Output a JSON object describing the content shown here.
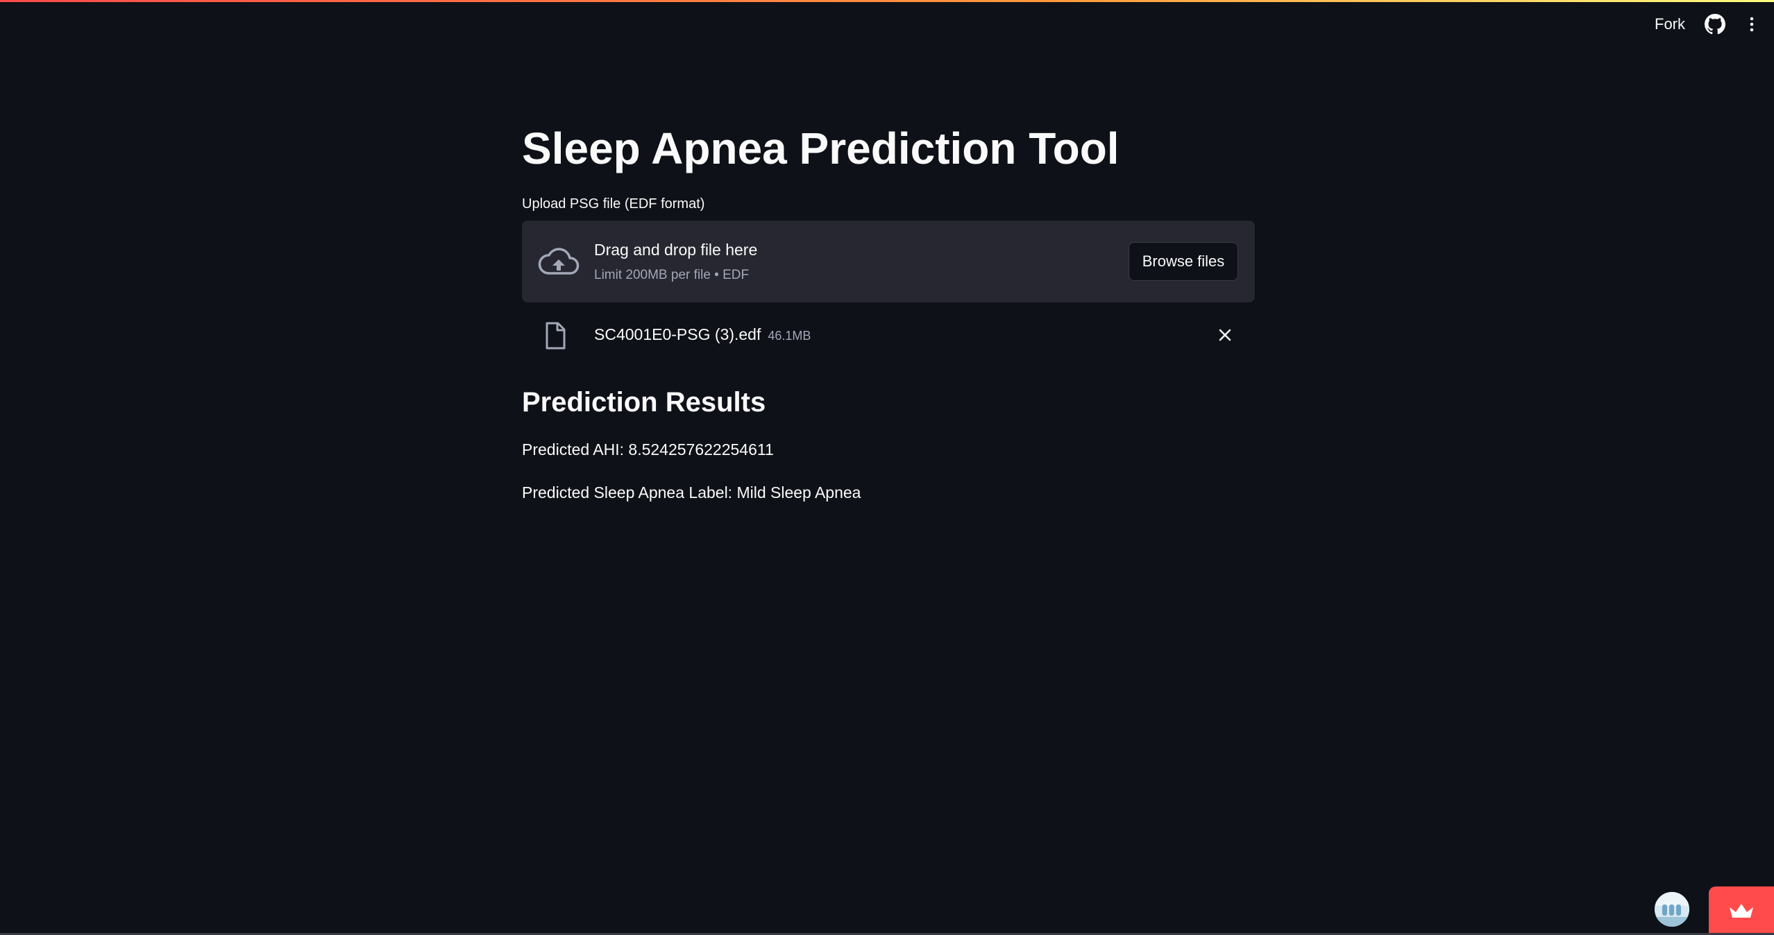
{
  "header": {
    "fork_label": "Fork",
    "github_icon": "github-icon",
    "menu_icon": "kebab-menu-icon"
  },
  "main": {
    "title": "Sleep Apnea Prediction Tool",
    "uploader": {
      "label": "Upload PSG file (EDF format)",
      "dropzone_title": "Drag and drop file here",
      "dropzone_subtitle": "Limit 200MB per file • EDF",
      "browse_button": "Browse files",
      "upload_icon": "cloud-upload-icon"
    },
    "uploaded_file": {
      "name": "SC4001E0-PSG (3).edf",
      "size": "46.1MB",
      "file_icon": "file-icon",
      "remove_icon": "close-icon"
    },
    "results": {
      "heading": "Prediction Results",
      "ahi_line": "Predicted AHI: 8.524257622254611",
      "label_line": "Predicted Sleep Apnea Label: Mild Sleep Apnea"
    }
  },
  "footer": {
    "avatar_icon": "user-avatar",
    "badge_icon": "crown-icon"
  },
  "colors": {
    "background": "#0e1117",
    "surface": "#262730",
    "text": "#fafafa",
    "muted_text": "#a3a8b8",
    "accent": "#ff4b4b"
  }
}
